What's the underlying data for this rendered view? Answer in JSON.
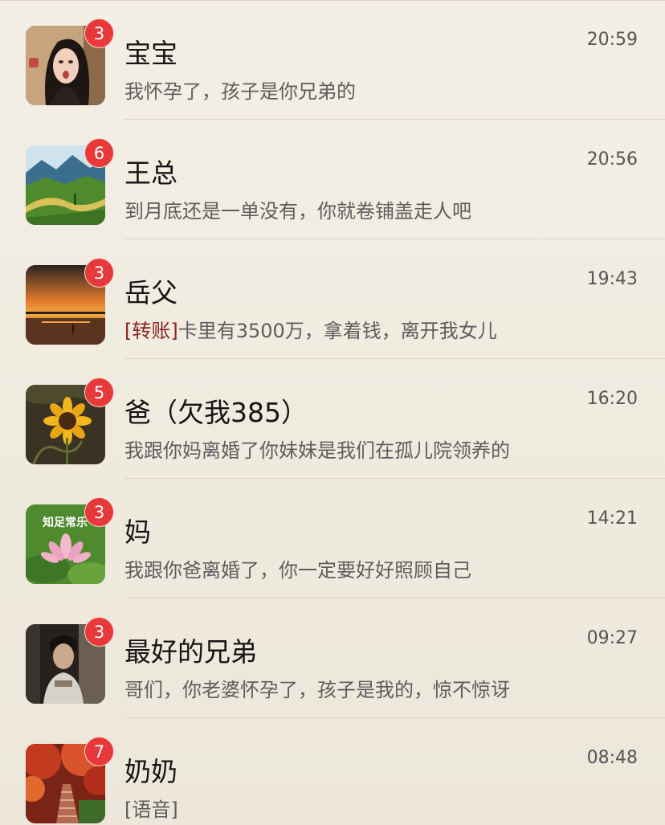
{
  "chats": [
    {
      "name": "宝宝",
      "time": "20:59",
      "badge": "3",
      "tag": "",
      "message": "我怀孕了，孩子是你兄弟的",
      "avatar": "woman-portrait-avatar"
    },
    {
      "name": "王总",
      "time": "20:56",
      "badge": "6",
      "tag": "",
      "message": "到月底还是一单没有，你就卷铺盖走人吧",
      "avatar": "landscape-river-avatar"
    },
    {
      "name": "岳父",
      "time": "19:43",
      "badge": "3",
      "tag": "[转账]",
      "message": "卡里有3500万，拿着钱，离开我女儿",
      "avatar": "sunset-lake-avatar"
    },
    {
      "name": "爸（欠我385）",
      "time": "16:20",
      "badge": "5",
      "tag": "",
      "message": "我跟你妈离婚了你妹妹是我们在孤儿院领养的",
      "avatar": "sunflower-avatar"
    },
    {
      "name": "妈",
      "time": "14:21",
      "badge": "3",
      "tag": "",
      "message": "我跟你爸离婚了，你一定要好好照顾自己",
      "avatar": "lotus-flower-avatar",
      "avatar_caption": "知足常乐"
    },
    {
      "name": "最好的兄弟",
      "time": "09:27",
      "badge": "3",
      "tag": "",
      "message": "哥们，你老婆怀孕了，孩子是我的，惊不惊讶",
      "avatar": "man-portrait-avatar"
    },
    {
      "name": "奶奶",
      "time": "08:48",
      "badge": "7",
      "tag": "",
      "message": "[语音]",
      "avatar": "autumn-stairs-avatar"
    }
  ],
  "colors": {
    "background": "#efebdf",
    "badge": "#e8393a",
    "divider": "#dcd6c9",
    "name_text": "#151515",
    "message_text": "#5d5d5d",
    "transfer_tag": "#8f2420"
  }
}
